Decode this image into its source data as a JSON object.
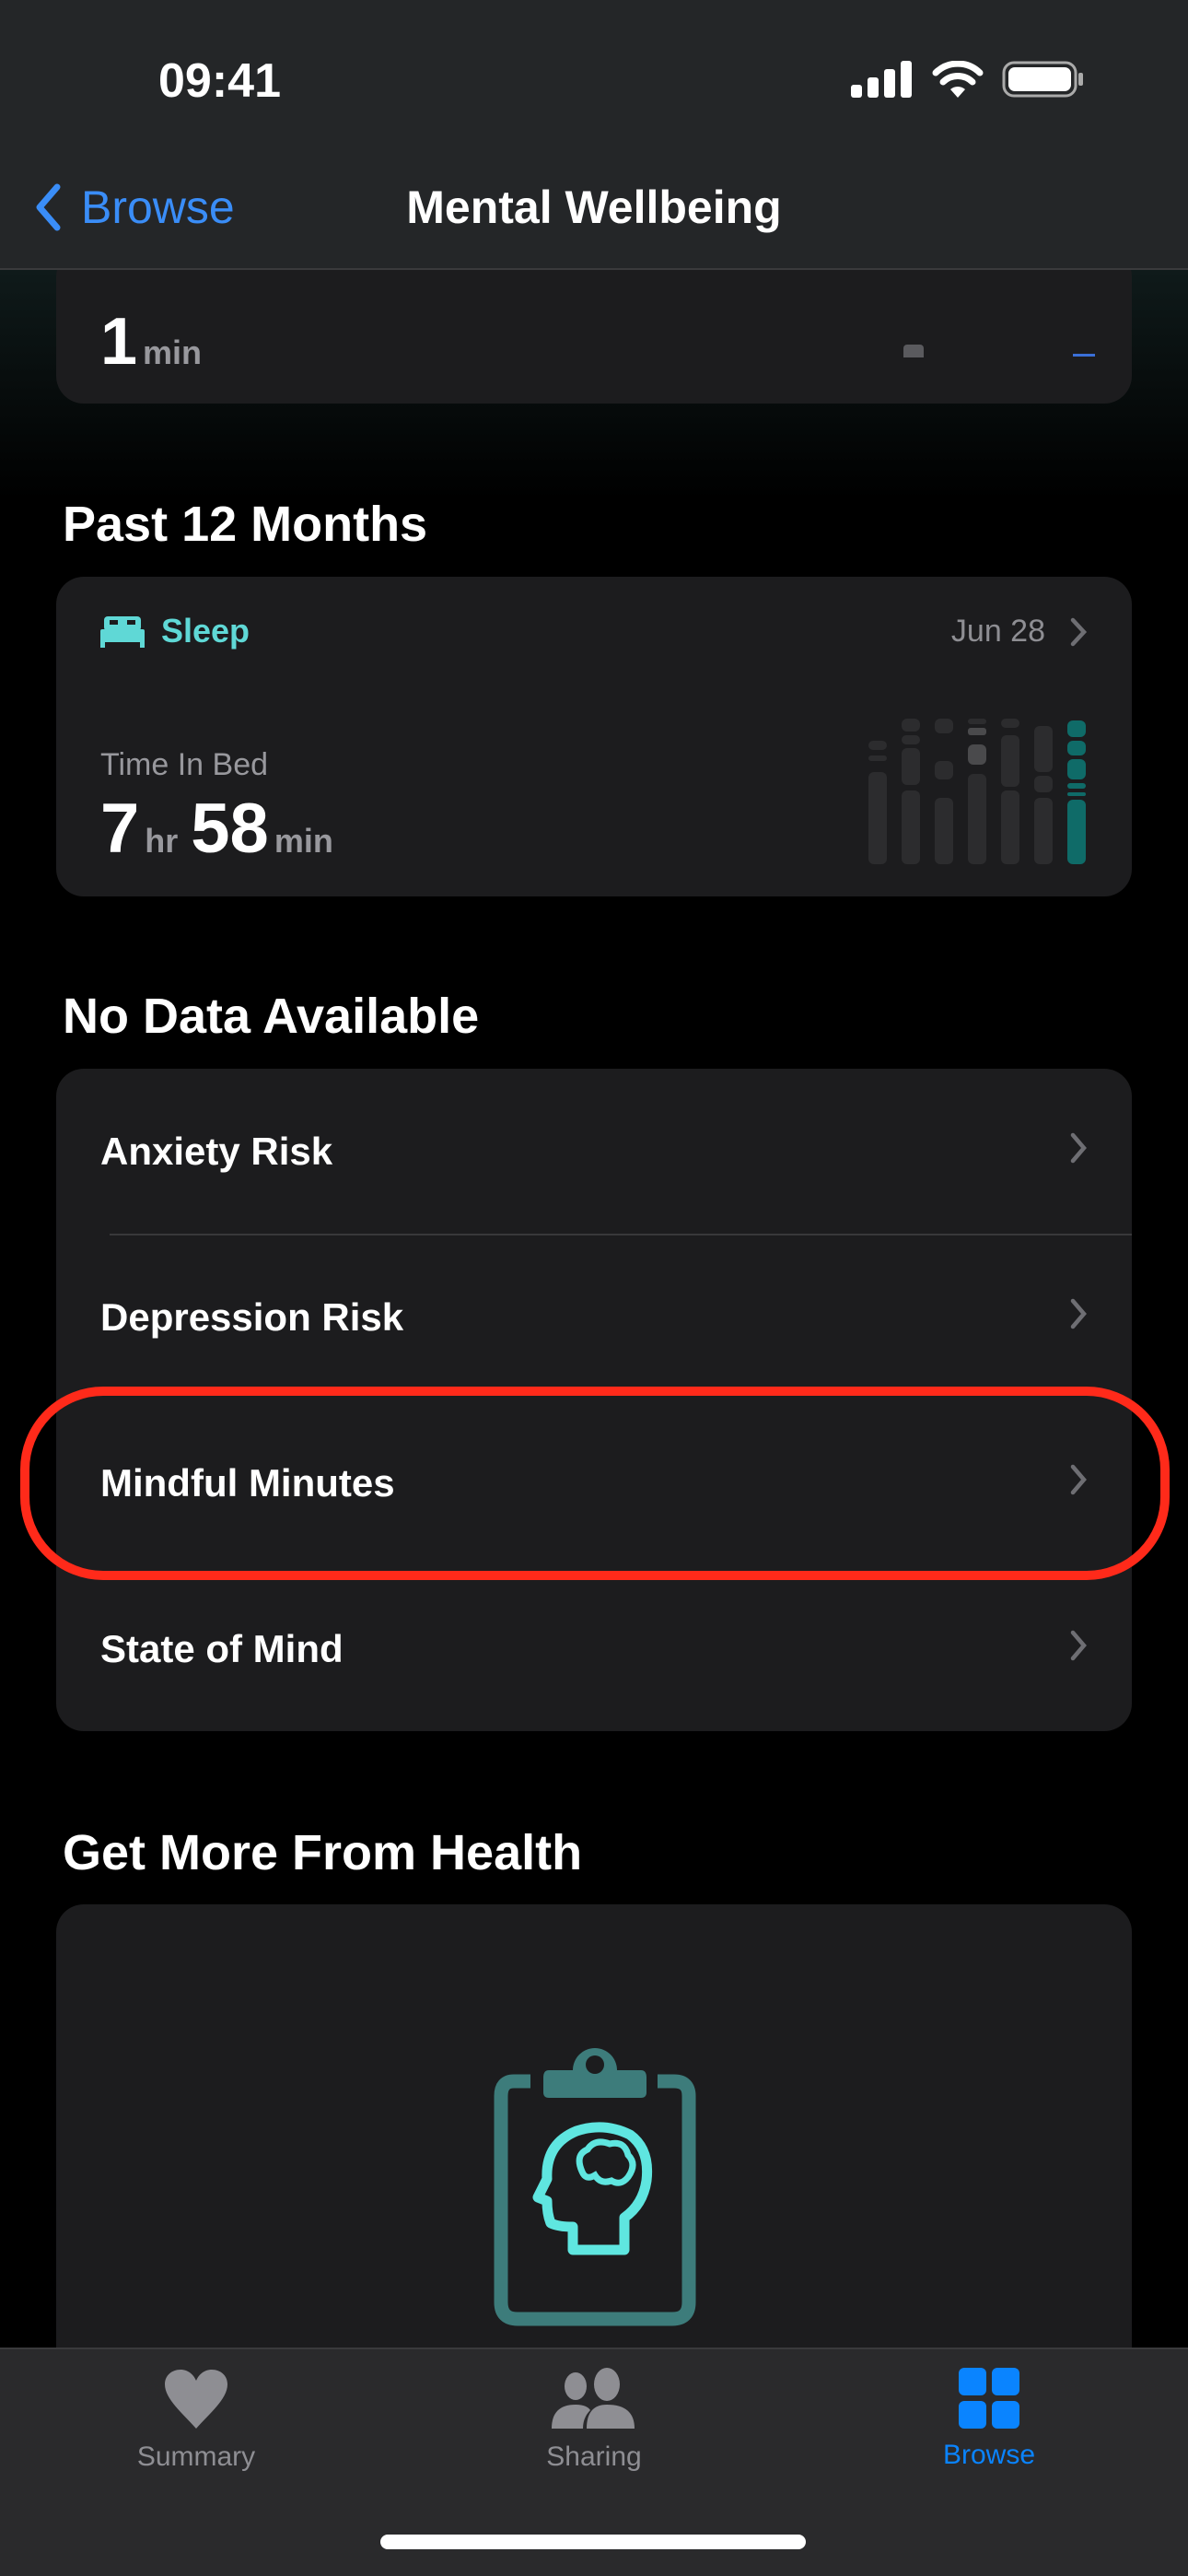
{
  "status_bar": {
    "time": "09:41"
  },
  "nav": {
    "back_label": "Browse",
    "title": "Mental Wellbeing"
  },
  "top_card": {
    "value": "1",
    "unit": "min"
  },
  "past_section": {
    "title": "Past 12 Months",
    "sleep_card": {
      "category": "Sleep",
      "date": "Jun 28",
      "metric": "Time In Bed",
      "hours": "7",
      "hours_unit": "hr",
      "minutes": "58",
      "minutes_unit": "min",
      "accent": "#5fd8d6"
    }
  },
  "no_data_section": {
    "title": "No Data Available",
    "items": [
      {
        "label": "Anxiety Risk"
      },
      {
        "label": "Depression Risk"
      },
      {
        "label": "Mindful Minutes",
        "highlighted": true
      },
      {
        "label": "State of Mind"
      }
    ]
  },
  "more_section": {
    "title": "Get More From Health"
  },
  "tab_bar": {
    "items": [
      {
        "label": "Summary",
        "icon": "heart-icon"
      },
      {
        "label": "Sharing",
        "icon": "people-icon"
      },
      {
        "label": "Browse",
        "icon": "grid-icon",
        "active": true
      }
    ]
  },
  "colors": {
    "accent": "#0a84ff",
    "highlight": "#ff2a1a",
    "teal": "#5fe6e0"
  }
}
